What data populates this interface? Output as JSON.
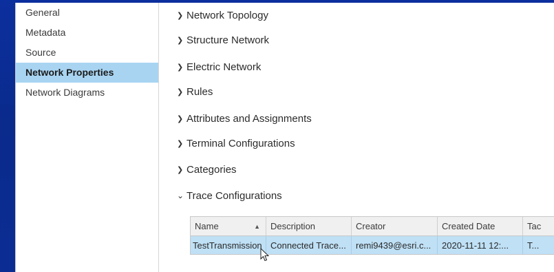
{
  "sidebar": {
    "items": [
      {
        "label": "General",
        "selected": false
      },
      {
        "label": "Metadata",
        "selected": false
      },
      {
        "label": "Source",
        "selected": false
      },
      {
        "label": "Network Properties",
        "selected": true
      },
      {
        "label": "Network Diagrams",
        "selected": false
      }
    ]
  },
  "sections": [
    {
      "label": "Network Topology",
      "expanded": false
    },
    {
      "label": "Structure Network",
      "expanded": false
    },
    {
      "label": "Electric Network",
      "expanded": false
    },
    {
      "label": "Rules",
      "expanded": false
    },
    {
      "label": "Attributes and Assignments",
      "expanded": false
    },
    {
      "label": "Terminal Configurations",
      "expanded": false
    },
    {
      "label": "Categories",
      "expanded": false
    },
    {
      "label": "Trace Configurations",
      "expanded": true
    }
  ],
  "icons": {
    "collapsed": "chevron-right-icon",
    "expanded": "chevron-down-icon",
    "sort": "sort-ascending-icon",
    "cursor": "mouse-pointer-icon"
  },
  "trace_table": {
    "columns": [
      "Name",
      "Description",
      "Creator",
      "Created Date",
      "Tag"
    ],
    "columns_visible": [
      "Name",
      "Description",
      "Creator",
      "Created Date",
      "Tac"
    ],
    "rows": [
      [
        "TestTransmission",
        "Connected Trace...",
        "remi9439@esri.c...",
        "2020-11-11 12:...",
        "T..."
      ]
    ]
  },
  "colors": {
    "background": "#0a2a8c",
    "selection": "#a8d4f2",
    "row_selection": "#bfe0f5"
  }
}
